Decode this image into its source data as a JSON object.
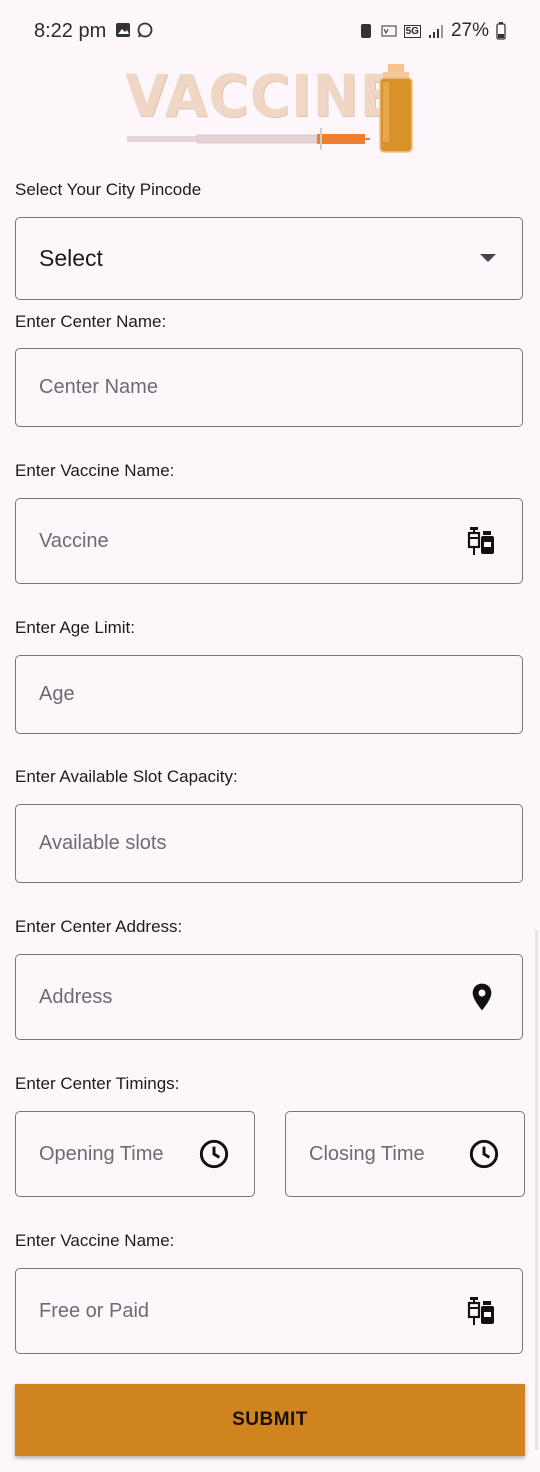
{
  "status_bar": {
    "time": "8:22 pm",
    "battery": "27%",
    "network_badge": "5G"
  },
  "logo": {
    "text": "VACCINE"
  },
  "pincode": {
    "label": "Select Your City Pincode",
    "value": "Select"
  },
  "center_name": {
    "label": "Enter Center Name:",
    "placeholder": "Center Name"
  },
  "vaccine_name": {
    "label": "Enter Vaccine Name:",
    "placeholder": "Vaccine",
    "icon": "vaccine-icon"
  },
  "age_limit": {
    "label": "Enter Age Limit:",
    "placeholder": "Age"
  },
  "slot_capacity": {
    "label": "Enter Available Slot Capacity:",
    "placeholder": "Available slots"
  },
  "center_address": {
    "label": "Enter Center Address:",
    "placeholder": "Address",
    "icon": "location-pin-icon"
  },
  "timings": {
    "label": "Enter Center Timings:",
    "opening_placeholder": "Opening Time",
    "closing_placeholder": "Closing Time",
    "icon": "clock-icon"
  },
  "fee_type": {
    "label": "Enter Vaccine Name:",
    "placeholder": "Free or Paid",
    "icon": "vaccine-icon"
  },
  "submit_label": "SUBMIT",
  "colors": {
    "accent": "#d08420",
    "background": "#fdf7fc",
    "outline": "#7b757f"
  }
}
